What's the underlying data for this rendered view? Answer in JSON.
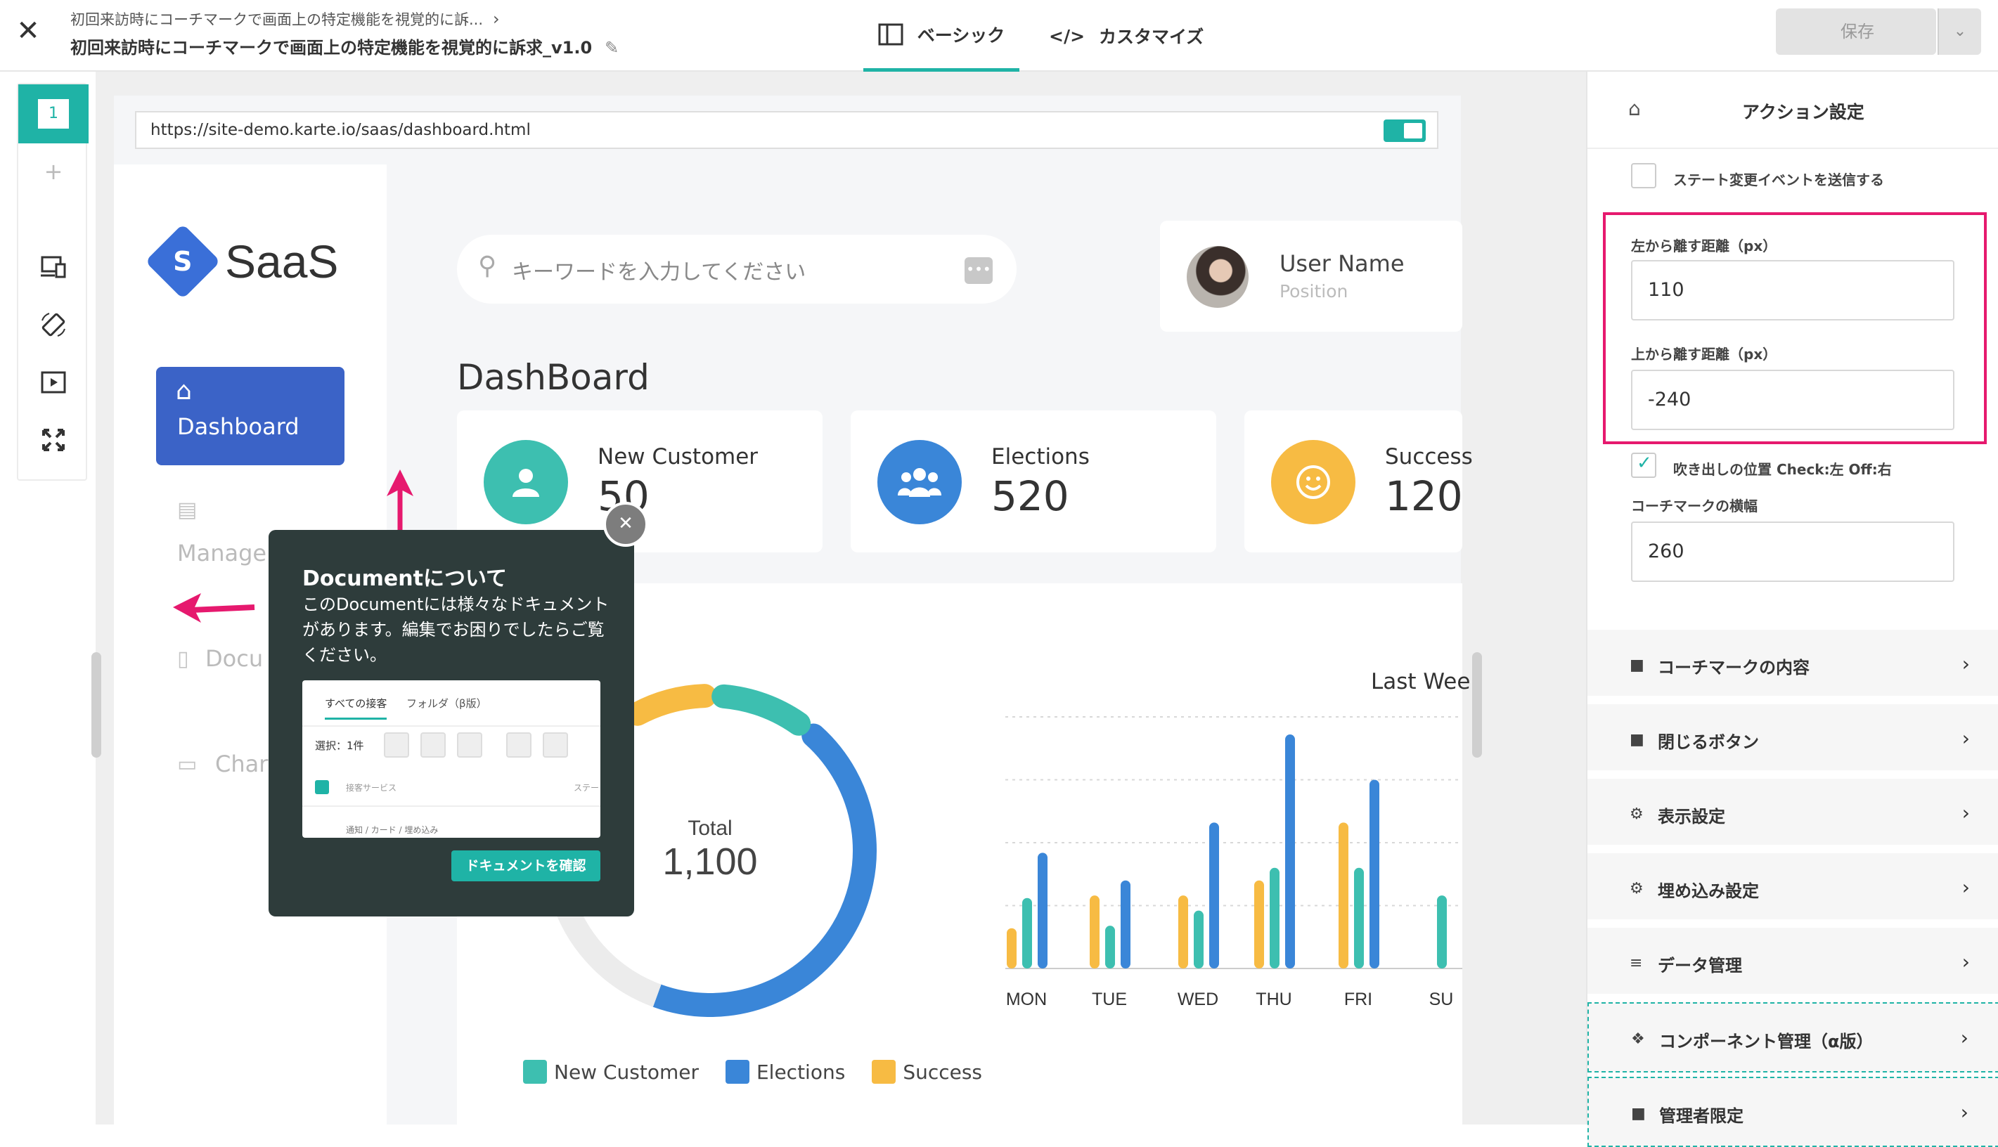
{
  "topbar": {
    "breadcrumb": "初回来訪時にコーチマークで画面上の特定機能を視覚的に訴...",
    "title": "初回来訪時にコーチマークで画面上の特定機能を視覚的に訴求_v1.0",
    "tabs": [
      {
        "label": "ベーシック"
      },
      {
        "label": "カスタマイズ"
      }
    ],
    "save_label": "保存"
  },
  "rail": {
    "page_number": "1"
  },
  "preview": {
    "url": "https://site-demo.karte.io/saas/dashboard.html",
    "logo_letter": "S",
    "logo_text": "SaaS",
    "nav": {
      "dashboard": "Dashboard",
      "manage": "Manage",
      "documents": "Docu",
      "chat": "Char"
    },
    "search_placeholder": "キーワードを入力してください",
    "user": {
      "name": "User Name",
      "position": "Position"
    },
    "page_title": "DashBoard",
    "stats": [
      {
        "label": "New Customer",
        "value": "50",
        "color": "#3dbfb0"
      },
      {
        "label": "Elections",
        "value": "520",
        "color": "#3a86d8"
      },
      {
        "label": "Success",
        "value": "120",
        "color": "#f7bb43"
      }
    ],
    "weekly_title": "Last Wee",
    "donut_label": "Total",
    "donut_total": "1,100",
    "legend": [
      "New Customer",
      "Elections",
      "Success"
    ],
    "popup": {
      "title": "Documentについて",
      "body": "このDocumentには様々なドキュメントがあります。編集でお困りでしたらご覧ください。",
      "button": "ドキュメントを確認",
      "shot_tab1": "すべての接客",
      "shot_tab2": "フォルダ（β版）",
      "shot_select": "選択：1件",
      "shot_row1": "接客サービス",
      "shot_row1_right": "ステー",
      "shot_row2": "通知 / カード / 埋め込み"
    }
  },
  "chart_data": [
    {
      "type": "pie",
      "title": "",
      "center_label": "Total",
      "center_value": "1,100",
      "series": [
        {
          "name": "Elections",
          "value": 520,
          "color": "#3a86d8"
        },
        {
          "name": "Success",
          "value": 120,
          "color": "#f7bb43"
        },
        {
          "name": "New Customer",
          "value": 50,
          "color": "#3dbfb0"
        }
      ]
    },
    {
      "type": "bar",
      "title": "Last Wee",
      "categories": [
        "MON",
        "TUE",
        "WED",
        "THU",
        "FRI",
        "SU"
      ],
      "series": [
        {
          "name": "Success",
          "color": "#f7bb43",
          "values": [
            16,
            29,
            29,
            35,
            58,
            0
          ]
        },
        {
          "name": "New Customer",
          "color": "#3dbfb0",
          "values": [
            28,
            17,
            23,
            40,
            40,
            29
          ]
        },
        {
          "name": "Elections",
          "color": "#3a86d8",
          "values": [
            46,
            35,
            58,
            93,
            75,
            0
          ]
        }
      ],
      "ylim": [
        0,
        100
      ],
      "grid": true
    }
  ],
  "panel": {
    "title": "アクション設定",
    "state_event_label": "ステート変更イベントを送信する",
    "left_label": "左から離す距離（px）",
    "left_value": "110",
    "top_label": "上から離す距離（px）",
    "top_value": "-240",
    "balloon_label": "吹き出しの位置 Check:左 Off:右",
    "width_label": "コーチマークの横幅",
    "width_value": "260",
    "sections": [
      {
        "label": "コーチマークの内容",
        "icon": "folder-icon"
      },
      {
        "label": "閉じるボタン",
        "icon": "folder-icon"
      },
      {
        "label": "表示設定",
        "icon": "gear-icon"
      },
      {
        "label": "埋め込み設定",
        "icon": "gear-icon"
      },
      {
        "label": "データ管理",
        "icon": "database-icon"
      },
      {
        "label": "コンポーネント管理（α版）",
        "icon": "components-icon"
      },
      {
        "label": "管理者限定",
        "icon": "folder-icon"
      }
    ],
    "accent_color": "#e6196e"
  }
}
